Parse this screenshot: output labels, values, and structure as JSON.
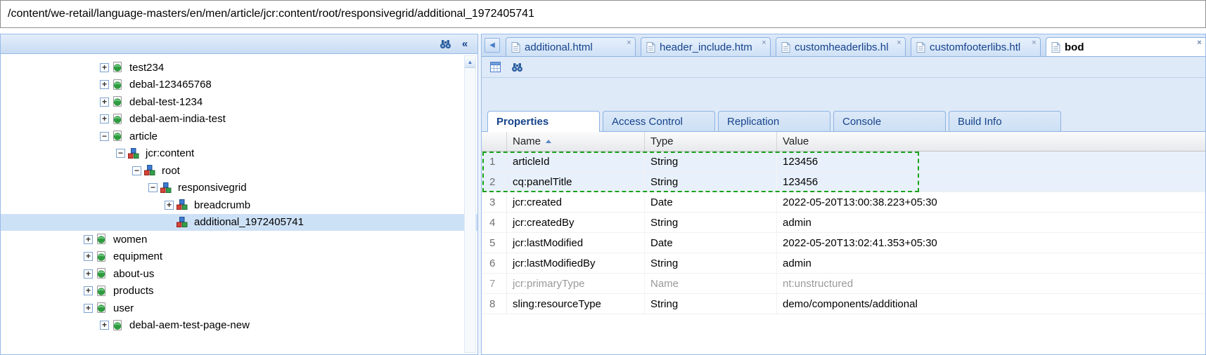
{
  "colors": {
    "accent_blue": "#15428b",
    "panel_border": "#99bbe8",
    "selection_marquee_green": "#1aa21a",
    "tree_selection_blue": "#cde1f6"
  },
  "path_bar": {
    "value": "/content/we-retail/language-masters/en/men/article/jcr:content/root/responsivegrid/additional_1972405741"
  },
  "tree_panel": {
    "header_buttons": [
      {
        "name": "find-icon",
        "icon": "find"
      },
      {
        "name": "collapse-panel-icon",
        "glyph": "«"
      }
    ],
    "scrollbar_up_glyph": "▲",
    "nodes": [
      {
        "label": "test234",
        "level": 1,
        "expander": "plus",
        "icon": "page",
        "selected": false
      },
      {
        "label": "debal-123465768",
        "level": 1,
        "expander": "plus",
        "icon": "page",
        "selected": false
      },
      {
        "label": "debal-test-1234",
        "level": 1,
        "expander": "plus",
        "icon": "page",
        "selected": false
      },
      {
        "label": "debal-aem-india-test",
        "level": 1,
        "expander": "plus",
        "icon": "page",
        "selected": false
      },
      {
        "label": "article",
        "level": 1,
        "expander": "minus",
        "icon": "page",
        "selected": false
      },
      {
        "label": "jcr:content",
        "level": 2,
        "expander": "minus",
        "icon": "node",
        "selected": false
      },
      {
        "label": "root",
        "level": 3,
        "expander": "minus",
        "icon": "node",
        "selected": false
      },
      {
        "label": "responsivegrid",
        "level": 4,
        "expander": "minus",
        "icon": "node",
        "selected": false
      },
      {
        "label": "breadcrumb",
        "level": 5,
        "expander": "plus",
        "icon": "node",
        "selected": false
      },
      {
        "label": "additional_1972405741",
        "level": 5,
        "expander": "none",
        "icon": "node",
        "selected": true
      },
      {
        "label": "women",
        "level": 0,
        "expander": "plus",
        "icon": "page",
        "selected": false
      },
      {
        "label": "equipment",
        "level": 0,
        "expander": "plus",
        "icon": "page",
        "selected": false
      },
      {
        "label": "about-us",
        "level": 0,
        "expander": "plus",
        "icon": "page",
        "selected": false
      },
      {
        "label": "products",
        "level": 0,
        "expander": "plus",
        "icon": "page",
        "selected": false
      },
      {
        "label": "user",
        "level": 0,
        "expander": "plus",
        "icon": "page",
        "selected": false
      },
      {
        "label": "debal-aem-test-page-new",
        "level": 1,
        "expander": "plus",
        "icon": "page",
        "selected": false
      }
    ]
  },
  "editor": {
    "back_button": {
      "name": "scroll-tabs-left-icon",
      "glyph": "◀"
    },
    "tabs": [
      {
        "label": "additional.html",
        "active": false,
        "close_glyph": "×"
      },
      {
        "label": "header_include.htm",
        "active": false,
        "close_glyph": "×"
      },
      {
        "label": "customheaderlibs.hl",
        "active": false,
        "close_glyph": "×"
      },
      {
        "label": "customfooterlibs.htl",
        "active": false,
        "close_glyph": "×"
      },
      {
        "label": "bod",
        "active": true,
        "close_glyph": "×"
      }
    ],
    "toolbar_buttons": [
      {
        "name": "node-grid-icon",
        "icon": "grid"
      },
      {
        "name": "search-icon",
        "icon": "find"
      }
    ]
  },
  "properties_panel": {
    "tabs": [
      {
        "label": "Properties",
        "active": true
      },
      {
        "label": "Access Control",
        "active": false
      },
      {
        "label": "Replication",
        "active": false
      },
      {
        "label": "Console",
        "active": false
      },
      {
        "label": "Build Info",
        "active": false
      }
    ],
    "columns": [
      {
        "label": "Name",
        "sort": "asc"
      },
      {
        "label": "Type",
        "sort": null
      },
      {
        "label": "Value",
        "sort": null
      }
    ],
    "rows": [
      {
        "num": "1",
        "name": "articleId",
        "type": "String",
        "value": "123456",
        "selected": true,
        "protected": false
      },
      {
        "num": "2",
        "name": "cq:panelTitle",
        "type": "String",
        "value": "123456",
        "selected": true,
        "protected": false
      },
      {
        "num": "3",
        "name": "jcr:created",
        "type": "Date",
        "value": "2022-05-20T13:00:38.223+05:30",
        "selected": false,
        "protected": false
      },
      {
        "num": "4",
        "name": "jcr:createdBy",
        "type": "String",
        "value": "admin",
        "selected": false,
        "protected": false
      },
      {
        "num": "5",
        "name": "jcr:lastModified",
        "type": "Date",
        "value": "2022-05-20T13:02:41.353+05:30",
        "selected": false,
        "protected": false
      },
      {
        "num": "6",
        "name": "jcr:lastModifiedBy",
        "type": "String",
        "value": "admin",
        "selected": false,
        "protected": false
      },
      {
        "num": "7",
        "name": "jcr:primaryType",
        "type": "Name",
        "value": "nt:unstructured",
        "selected": false,
        "protected": true
      },
      {
        "num": "8",
        "name": "sling:resourceType",
        "type": "String",
        "value": "demo/components/additional",
        "selected": false,
        "protected": false
      }
    ]
  }
}
